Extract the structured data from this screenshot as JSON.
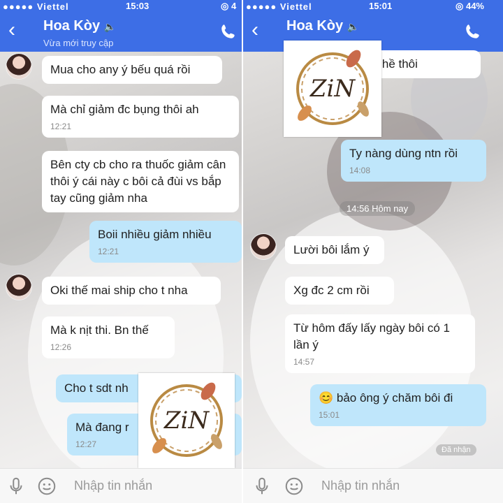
{
  "colors": {
    "header": "#3d6ee6",
    "incoming": "#ffffff",
    "outgoing": "#bfe6fb"
  },
  "left": {
    "status": {
      "signal": "●●●●● Viettel",
      "time": "15:03",
      "battery": "4"
    },
    "header": {
      "back": "‹",
      "contact": "Hoa Kòy",
      "subtitle": "Vừa mới truy cập",
      "sound_icon": "🔈",
      "call_icon": "phone-icon"
    },
    "messages": [
      {
        "dir": "in",
        "text": "Mua cho any ý bếu quá rồi"
      },
      {
        "dir": "in",
        "text": "Mà chỉ giảm đc bụng thôi ah",
        "time": "12:21"
      },
      {
        "dir": "in",
        "text": "Bên cty cb cho ra thuốc giảm cân thôi ý cái này c bôi cả đùi vs bắp tay cũng giảm nha"
      },
      {
        "dir": "out",
        "text": "Boii nhiều giảm nhiều",
        "time": "12:21"
      },
      {
        "dir": "in",
        "text": "Oki thế mai ship cho t nha"
      },
      {
        "dir": "in",
        "text": "Mà k nịt thi. Bn thế",
        "time": "12:26"
      },
      {
        "dir": "out",
        "text": "Cho t sdt nh"
      },
      {
        "dir": "out",
        "text": "Mà đang r",
        "time": "12:27"
      }
    ],
    "input": {
      "placeholder": "Nhập tin nhắn"
    },
    "watermark": "ZiN"
  },
  "right": {
    "status": {
      "signal": "●●●●● Viettel",
      "time": "15:01",
      "battery": "44%"
    },
    "header": {
      "back": "‹",
      "contact": "Hoa Kòy",
      "sound_icon": "🔈",
      "call_icon": "phone-icon"
    },
    "messages": [
      {
        "dir": "in",
        "text": "ối nghề thôi"
      },
      {
        "dir": "out",
        "text": "Ty nàng dùng ntn rồi",
        "time": "14:08"
      },
      {
        "dir": "in",
        "text": "Lười bôi lắm ý"
      },
      {
        "dir": "in",
        "text": "Xg đc 2 cm rồi"
      },
      {
        "dir": "in",
        "text": "Từ hôm đấy lấy ngày bôi có 1 lần ý",
        "time": "14:57"
      },
      {
        "dir": "out",
        "text": "😊 bảo ông ý chăm bôi đi",
        "time": "15:01"
      }
    ],
    "date_pill": "14:56 Hôm nay",
    "seen": "Đã nhận",
    "input": {
      "placeholder": "Nhập tin nhắn"
    },
    "watermark": "ZiN"
  }
}
